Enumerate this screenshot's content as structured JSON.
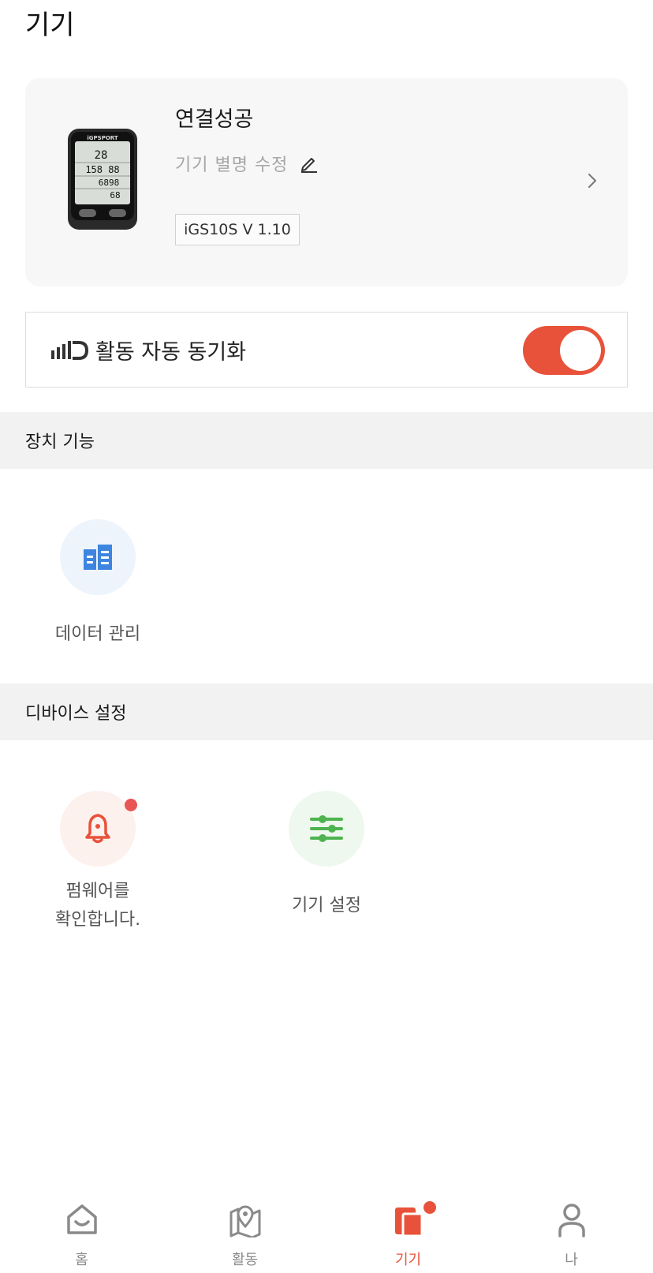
{
  "page": {
    "title": "기기"
  },
  "device": {
    "status": "연결성공",
    "alias_edit_label": "기기 별명 수정",
    "version": "iGS10S V 1.10",
    "screen_brand": "iGPSPORT",
    "screen_values": [
      "28",
      "158 88",
      "6898",
      "68"
    ]
  },
  "sync": {
    "label": "활동 자동 동기화",
    "enabled": true
  },
  "sections": {
    "device_functions": {
      "title": "장치 기능",
      "items": [
        {
          "label": "데이터 관리",
          "icon": "data-management-icon"
        }
      ]
    },
    "device_settings": {
      "title": "디바이스 설정",
      "items": [
        {
          "label_line1": "펌웨어를",
          "label_line2": "확인합니다.",
          "icon": "bell-icon",
          "has_notification": true
        },
        {
          "label": "기기 설정",
          "icon": "sliders-icon"
        }
      ]
    }
  },
  "bottom_nav": {
    "items": [
      {
        "label": "홈",
        "icon": "home-icon"
      },
      {
        "label": "활동",
        "icon": "map-pin-icon"
      },
      {
        "label": "기기",
        "icon": "device-icon",
        "active": true,
        "badge": true
      },
      {
        "label": "나",
        "icon": "person-icon"
      }
    ]
  },
  "colors": {
    "accent": "#e8523a",
    "blue": "#3d85e0",
    "green": "#4fb34f",
    "badge": "#e95555"
  }
}
